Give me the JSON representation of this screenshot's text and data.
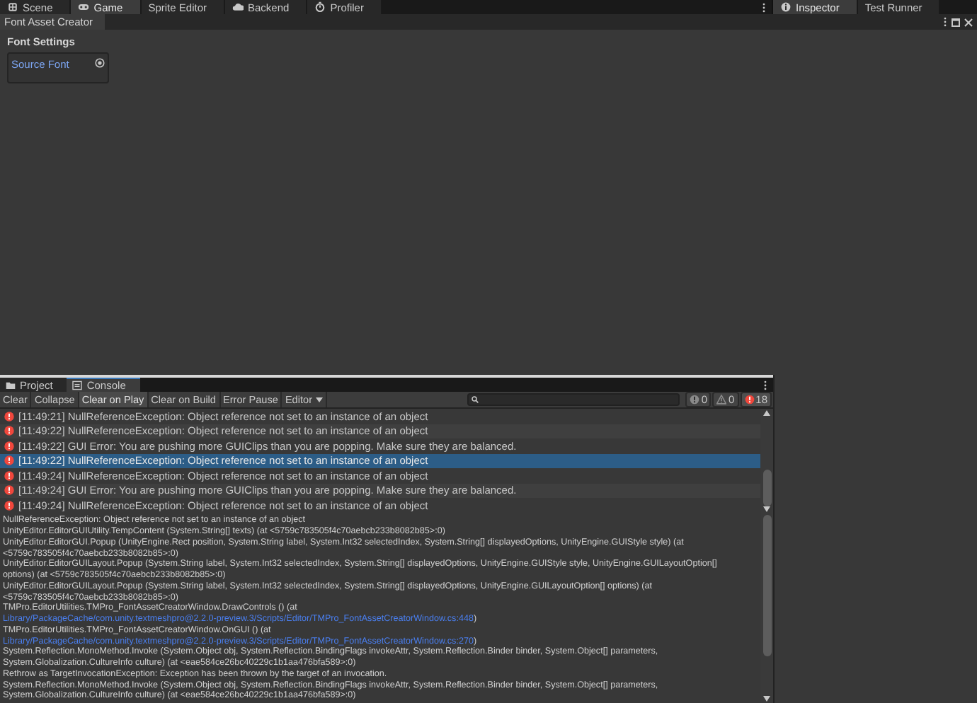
{
  "top_tabs": [
    {
      "label": "Scene",
      "selected": false
    },
    {
      "label": "Game",
      "selected": true
    },
    {
      "label": "Sprite Editor",
      "selected": false
    },
    {
      "label": "Backend",
      "selected": false
    },
    {
      "label": "Profiler",
      "selected": false
    }
  ],
  "side_tabs": [
    {
      "label": "Inspector",
      "selected": true
    },
    {
      "label": "Test Runner",
      "selected": false
    }
  ],
  "creator": {
    "title": "Font Asset Creator",
    "section": "Font Settings",
    "field_label": "Source Font"
  },
  "console": {
    "tabs": [
      {
        "label": "Project",
        "selected": false
      },
      {
        "label": "Console",
        "selected": true
      }
    ],
    "toolbar": [
      {
        "label": "Clear",
        "kind": "button",
        "selected": false
      },
      {
        "label": "Collapse",
        "kind": "toggle",
        "selected": false
      },
      {
        "label": "Clear on Play",
        "kind": "toggle",
        "selected": true
      },
      {
        "label": "Clear on Build",
        "kind": "toggle",
        "selected": false
      },
      {
        "label": "Error Pause",
        "kind": "toggle",
        "selected": false
      },
      {
        "label": "Editor",
        "kind": "dropdown",
        "selected": false
      }
    ],
    "counters": [
      {
        "kind": "info",
        "count": "0",
        "on": false
      },
      {
        "kind": "warning",
        "count": "0",
        "on": false
      },
      {
        "kind": "error",
        "count": "18",
        "on": true
      }
    ],
    "logs": [
      {
        "text": "[11:49:21] NullReferenceException: Object reference not set to an instance of an object",
        "selected": false
      },
      {
        "text": "[11:49:22] NullReferenceException: Object reference not set to an instance of an object",
        "selected": false
      },
      {
        "text": "[11:49:22] GUI Error: You are pushing more GUIClips than you are popping. Make sure they are balanced.",
        "selected": false
      },
      {
        "text": "[11:49:22] NullReferenceException: Object reference not set to an instance of an object",
        "selected": true
      },
      {
        "text": "[11:49:24] NullReferenceException: Object reference not set to an instance of an object",
        "selected": false
      },
      {
        "text": "[11:49:24] GUI Error: You are pushing more GUIClips than you are popping. Make sure they are balanced.",
        "selected": false
      },
      {
        "text": "[11:49:24] NullReferenceException: Object reference not set to an instance of an object",
        "selected": false
      }
    ],
    "details": [
      [
        {
          "text": "NullReferenceException: Object reference not set to an instance of an object",
          "link": false
        }
      ],
      [
        {
          "text": "UnityEditor.EditorGUIUtility.TempContent (System.String[] texts) (at <5759c783505f4c70aebcb233b8082b85>:0)",
          "link": false
        }
      ],
      [
        {
          "text": "UnityEditor.EditorGUI.Popup (UnityEngine.Rect position, System.String label, System.Int32 selectedIndex, System.String[] displayedOptions, UnityEngine.GUIStyle style) (at",
          "link": false
        }
      ],
      [
        {
          "text": "<5759c783505f4c70aebcb233b8082b85>:0)",
          "link": false
        }
      ],
      [
        {
          "text": "UnityEditor.EditorGUILayout.Popup (System.String label, System.Int32 selectedIndex, System.String[] displayedOptions, UnityEngine.GUIStyle style, UnityEngine.GUILayoutOption[]",
          "link": false
        }
      ],
      [
        {
          "text": "options) (at <5759c783505f4c70aebcb233b8082b85>:0)",
          "link": false
        }
      ],
      [
        {
          "text": "UnityEditor.EditorGUILayout.Popup (System.String label, System.Int32 selectedIndex, System.String[] displayedOptions, UnityEngine.GUILayoutOption[] options) (at",
          "link": false
        }
      ],
      [
        {
          "text": "<5759c783505f4c70aebcb233b8082b85>:0)",
          "link": false
        }
      ],
      [
        {
          "text": "TMPro.EditorUtilities.TMPro_FontAssetCreatorWindow.DrawControls () (at",
          "link": false
        }
      ],
      [
        {
          "text": "Library/PackageCache/com.unity.textmeshpro@2.2.0-preview.3/Scripts/Editor/TMPro_FontAssetCreatorWindow.cs:448",
          "link": true
        },
        {
          "text": ")",
          "link": false
        }
      ],
      [
        {
          "text": "TMPro.EditorUtilities.TMPro_FontAssetCreatorWindow.OnGUI () (at",
          "link": false
        }
      ],
      [
        {
          "text": "Library/PackageCache/com.unity.textmeshpro@2.2.0-preview.3/Scripts/Editor/TMPro_FontAssetCreatorWindow.cs:270",
          "link": true
        },
        {
          "text": ")",
          "link": false
        }
      ],
      [
        {
          "text": "System.Reflection.MonoMethod.Invoke (System.Object obj, System.Reflection.BindingFlags invokeAttr, System.Reflection.Binder binder, System.Object[] parameters,",
          "link": false
        }
      ],
      [
        {
          "text": "System.Globalization.CultureInfo culture) (at <eae584ce26bc40229c1b1aa476bfa589>:0)",
          "link": false
        }
      ],
      [
        {
          "text": "Rethrow as TargetInvocationException: Exception has been thrown by the target of an invocation.",
          "link": false
        }
      ],
      [
        {
          "text": "System.Reflection.MonoMethod.Invoke (System.Object obj, System.Reflection.BindingFlags invokeAttr, System.Reflection.Binder binder, System.Object[] parameters,",
          "link": false
        }
      ],
      [
        {
          "text": "System.Globalization.CultureInfo culture) (at <eae584ce26bc40229c1b1aa476bfa589>:0)",
          "link": false
        }
      ]
    ]
  }
}
